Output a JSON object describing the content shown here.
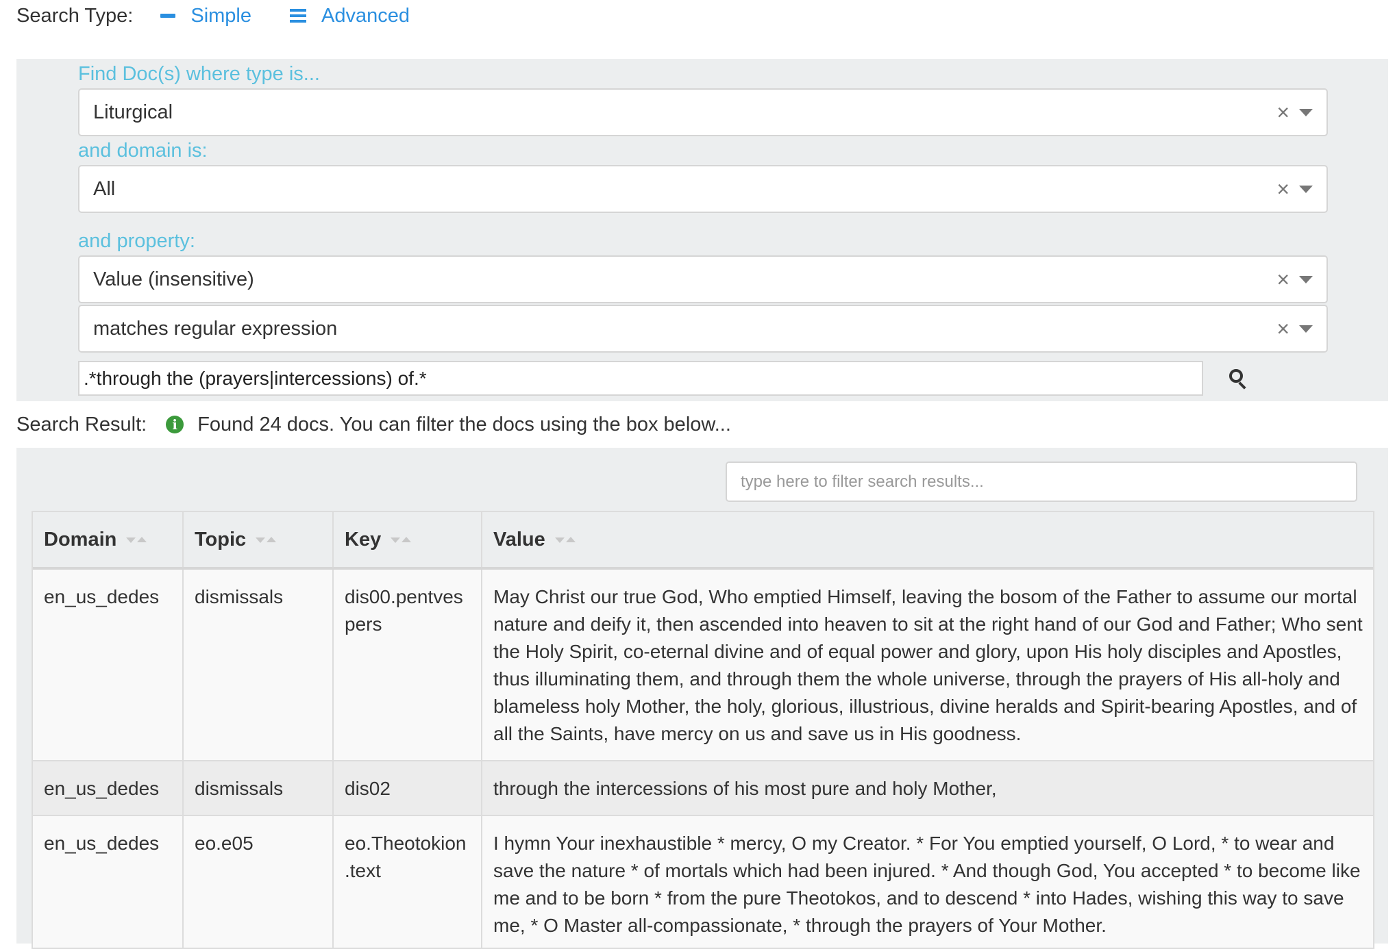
{
  "search_type": {
    "label": "Search Type:",
    "simple_label": "Simple",
    "advanced_label": "Advanced"
  },
  "query": {
    "type_label": "Find Doc(s) where type is...",
    "type_value": "Liturgical",
    "domain_label": "and domain is:",
    "domain_value": "All",
    "property_label": "and property:",
    "property_value": "Value (insensitive)",
    "operator_value": "matches regular expression",
    "regex_value": ".*through the (prayers|intercessions) of.*"
  },
  "result": {
    "label": "Search Result:",
    "message": "Found 24 docs. You can filter the docs using the box below..."
  },
  "filter": {
    "placeholder": "type here to filter search results..."
  },
  "table": {
    "headers": [
      "Domain",
      "Topic",
      "Key",
      "Value"
    ],
    "rows": [
      {
        "domain": "en_us_dedes",
        "topic": "dismissals",
        "key": "dis00.pentvespers",
        "value": "May Christ our true God, Who emptied Himself, leaving the bosom of the Father to assume our mortal nature and deify it, then ascended into heaven to sit at the right hand of our God and Father; Who sent the Holy Spirit, co-eternal divine and of equal power and glory, upon His holy disciples and Apostles, thus illuminating them, and through them the whole universe, through the prayers of His all-holy and blameless holy Mother, the holy, glorious, illustrious, divine heralds and Spirit-bearing Apostles, and of all the Saints, have mercy on us and save us in His goodness."
      },
      {
        "domain": "en_us_dedes",
        "topic": "dismissals",
        "key": "dis02",
        "value": "through the intercessions of his most pure and holy Mother,"
      },
      {
        "domain": "en_us_dedes",
        "topic": "eo.e05",
        "key": "eo.Theotokion.text",
        "value": "I hymn Your inexhaustible * mercy, O my Creator. * For You emptied yourself, O Lord, * to wear and save the nature * of mortals which had been injured. * And though God, You accepted * to become like me and to be born * from the pure Theotokos, and to descend * into Hades, wishing this way to save me, * O Master all-compassionate, * through the prayers of Your Mother."
      }
    ]
  },
  "colors": {
    "link": "#2a8fe0",
    "field_label": "#5bc0de",
    "panel_bg": "#eceeef",
    "info_icon": "#3c9a3c"
  }
}
